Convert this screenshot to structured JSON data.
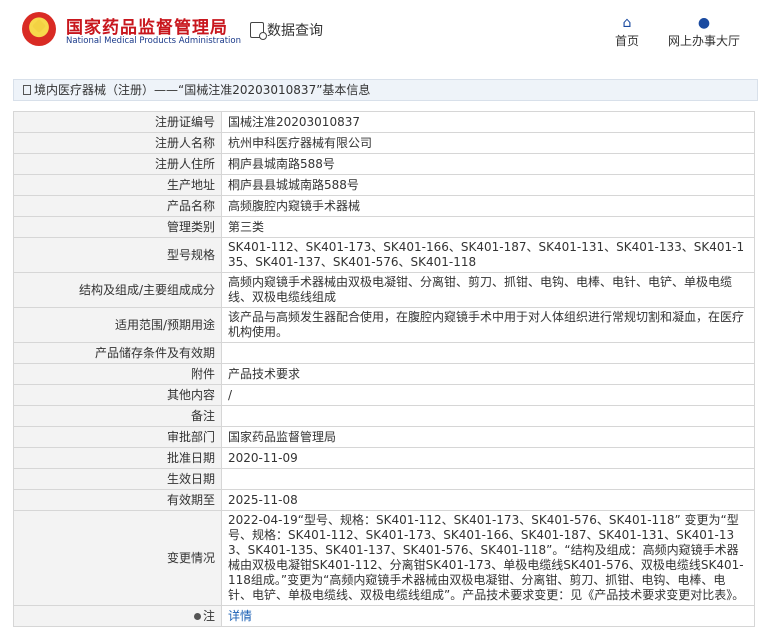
{
  "header": {
    "logo_cn": "国家药品监督管理局",
    "logo_en": "National Medical Products Administration",
    "data_query": "数据查询",
    "nav": {
      "home": "首页",
      "office": "网上办事大厅"
    }
  },
  "breadcrumb": "境内医疗器械（注册）——“国械注准20203010837”基本信息",
  "rows": [
    {
      "label": "注册证编号",
      "value": "国械注准20203010837"
    },
    {
      "label": "注册人名称",
      "value": "杭州申科医疗器械有限公司"
    },
    {
      "label": "注册人住所",
      "value": "桐庐县城南路588号"
    },
    {
      "label": "生产地址",
      "value": "桐庐县县城城南路588号"
    },
    {
      "label": "产品名称",
      "value": "高频腹腔内窥镜手术器械"
    },
    {
      "label": "管理类别",
      "value": "第三类"
    },
    {
      "label": "型号规格",
      "value": "SK401-112、SK401-173、SK401-166、SK401-187、SK401-131、SK401-133、SK401-135、SK401-137、SK401-576、SK401-118"
    },
    {
      "label": "结构及组成/主要组成成分",
      "value": "高频内窥镜手术器械由双极电凝钳、分离钳、剪刀、抓钳、电钩、电棒、电针、电铲、单极电缆线、双极电缆线组成"
    },
    {
      "label": "适用范围/预期用途",
      "value": "该产品与高频发生器配合使用，在腹腔内窥镜手术中用于对人体组织进行常规切割和凝血，在医疗机构使用。"
    },
    {
      "label": "产品储存条件及有效期",
      "value": ""
    },
    {
      "label": "附件",
      "value": "产品技术要求"
    },
    {
      "label": "其他内容",
      "value": "/"
    },
    {
      "label": "备注",
      "value": ""
    },
    {
      "label": "审批部门",
      "value": "国家药品监督管理局"
    },
    {
      "label": "批准日期",
      "value": "2020-11-09"
    },
    {
      "label": "生效日期",
      "value": ""
    },
    {
      "label": "有效期至",
      "value": "2025-11-08"
    },
    {
      "label": "变更情况",
      "value": "2022-04-19“型号、规格：SK401-112、SK401-173、SK401-576、SK401-118” 变更为“型号、规格：SK401-112、SK401-173、SK401-166、SK401-187、SK401-131、SK401-133、SK401-135、SK401-137、SK401-576、SK401-118”。“结构及组成：高频内窥镜手术器械由双极电凝钳SK401-112、分离钳SK401-173、单极电缆线SK401-576、双极电缆线SK401-118组成。”变更为“高频内窥镜手术器械由双极电凝钳、分离钳、剪刀、抓钳、电钩、电棒、电针、电铲、单极电缆线、双极电缆线组成”。产品技术要求变更：见《产品技术要求变更对比表》。"
    }
  ],
  "footer_row": {
    "label": "注",
    "link": "详情"
  }
}
